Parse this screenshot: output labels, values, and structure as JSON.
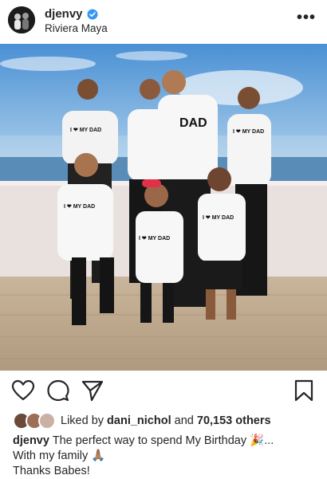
{
  "post": {
    "username": "djenvy",
    "location": "Riviera Maya",
    "more_icon": "ellipsis-icon"
  },
  "photo": {
    "shirt_text_center": "DAD",
    "shirt_text_small": "I ❤ MY DAD"
  },
  "actions": {
    "icons": [
      "heart-icon",
      "comment-icon",
      "share-icon",
      "bookmark-icon"
    ]
  },
  "likes": {
    "prefix": "Liked by",
    "user": "dani_nichol",
    "middle": "and",
    "count": "70,153 others"
  },
  "caption": {
    "username": "djenvy",
    "line1_text": "The perfect way to spend My Birthday 🎉...",
    "line2": "With my family 🙏🏽",
    "line3": "Thanks Babes!"
  },
  "colors": {
    "verified": "#3897f0",
    "sky_top": "#4f97d6",
    "sea": "#2d6a9e"
  }
}
